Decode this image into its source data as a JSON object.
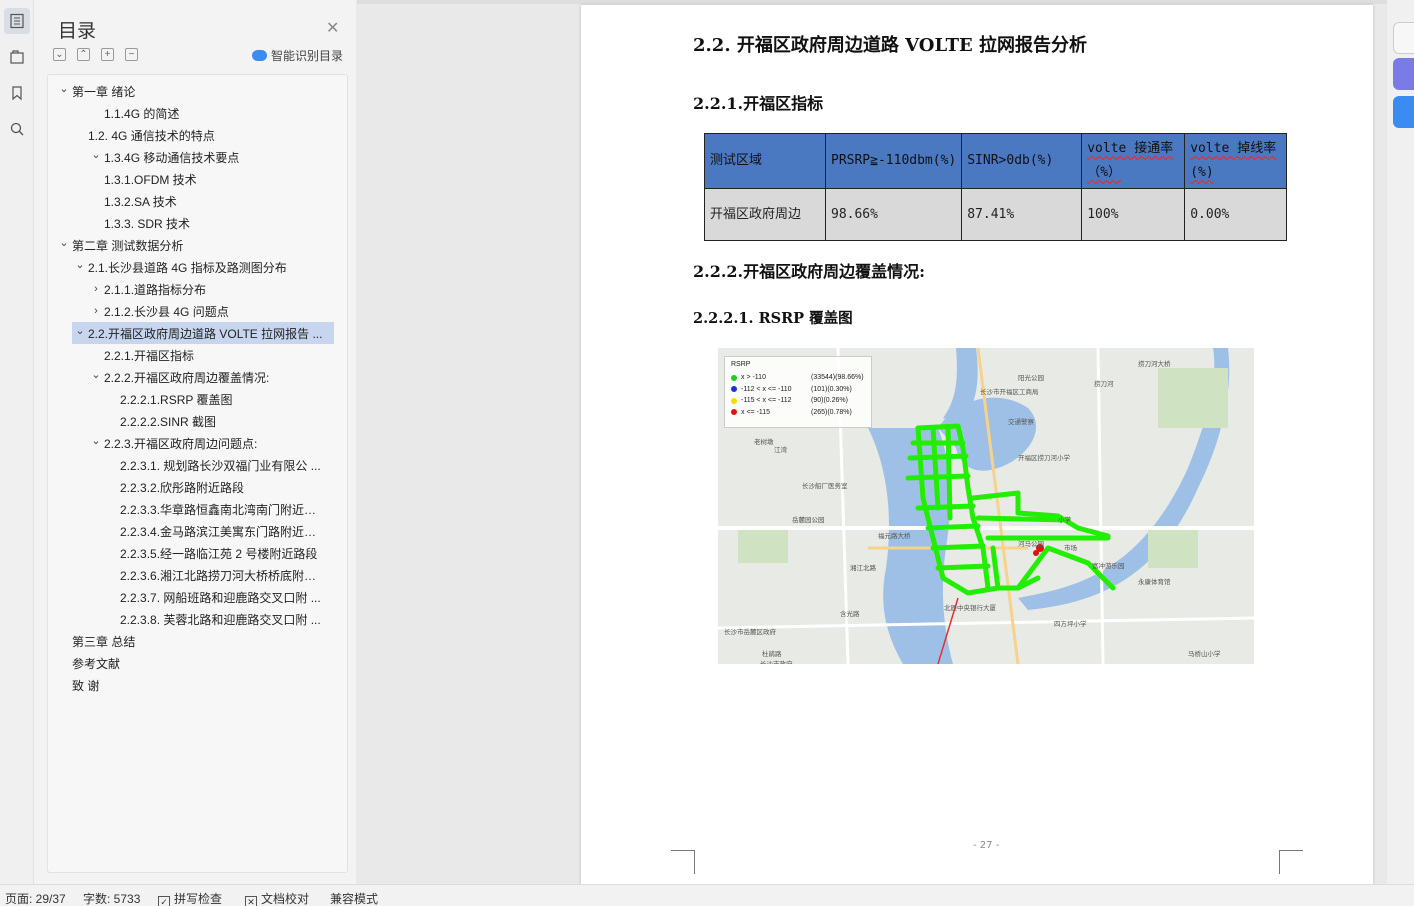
{
  "toc_panel": {
    "title": "目录",
    "smart_toc_label": "智能识别目录",
    "items": [
      {
        "label": "第一章  绪论",
        "caret": "v"
      },
      {
        "label": "1.1.4G 的简述",
        "caret": ""
      },
      {
        "label": "1.2.  4G 通信技术的特点",
        "caret": ""
      },
      {
        "label": "1.3.4G 移动通信技术要点",
        "caret": "v"
      },
      {
        "label": "1.3.1.OFDM 技术",
        "caret": ""
      },
      {
        "label": "1.3.2.SA 技术",
        "caret": ""
      },
      {
        "label": "1.3.3.  SDR 技术",
        "caret": ""
      },
      {
        "label": "第二章  测试数据分析",
        "caret": "v"
      },
      {
        "label": "2.1.长沙县道路 4G 指标及路测图分布",
        "caret": "v"
      },
      {
        "label": "2.1.1.道路指标分布",
        "caret": ">"
      },
      {
        "label": "2.1.2.长沙县 4G 问题点",
        "caret": ">"
      },
      {
        "label": "2.2.开福区政府周边道路 VOLTE 拉网报告 ...",
        "caret": "v",
        "selected": true
      },
      {
        "label": "2.2.1.开福区指标",
        "caret": ""
      },
      {
        "label": "2.2.2.开福区政府周边覆盖情况:",
        "caret": "v"
      },
      {
        "label": "2.2.2.1.RSRP 覆盖图",
        "caret": ""
      },
      {
        "label": "2.2.2.2.SINR 截图",
        "caret": ""
      },
      {
        "label": "2.2.3.开福区政府周边问题点:",
        "caret": "v"
      },
      {
        "label": "2.2.3.1.  规划路长沙双福门业有限公 ...",
        "caret": ""
      },
      {
        "label": "2.2.3.2.欣彤路附近路段",
        "caret": ""
      },
      {
        "label": "2.2.3.3.华章路恒鑫南北湾南门附近路 ...",
        "caret": ""
      },
      {
        "label": "2.2.3.4.金马路滨江美寓东门路附近路 ...",
        "caret": ""
      },
      {
        "label": "2.2.3.5.经一路临江苑 2 号楼附近路段",
        "caret": ""
      },
      {
        "label": "2.2.3.6.湘江北路捞刀河大桥桥底附近 ...",
        "caret": ""
      },
      {
        "label": "2.2.3.7.  网船班路和迎鹿路交叉口附 ...",
        "caret": ""
      },
      {
        "label": "2.2.3.8.  芙蓉北路和迎鹿路交叉口附 ...",
        "caret": ""
      },
      {
        "label": "第三章  总结",
        "caret": ""
      },
      {
        "label": "参考文献",
        "caret": ""
      },
      {
        "label": "致    谢",
        "caret": ""
      }
    ]
  },
  "document": {
    "section_title": "2.2.   开福区政府周边道路 VOLTE 拉网报告分析",
    "sub_title_1": "2.2.1.开福区指标",
    "table": {
      "headers": [
        "测试区域",
        "PRSRP≧-110dbm(%)",
        "SINR>0db(%)",
        "volte 接通率（%）",
        "volte 掉线率(%)"
      ],
      "rows": [
        [
          "开福区政府周边",
          "98.66%",
          "87.41%",
          "100%",
          "0.00%"
        ]
      ]
    },
    "sub_title_2": "2.2.2.开福区政府周边覆盖情况:",
    "subsub_title": "2.2.2.1.   RSRP 覆盖图",
    "map_legend": {
      "title": "RSRP",
      "entries": [
        {
          "range": "x > -110",
          "stat": "(33544)(98.66%)",
          "color": "#22cc22"
        },
        {
          "range": "-112 < x <= -110",
          "stat": "(101)(0.30%)",
          "color": "#1a35d6"
        },
        {
          "range": "-115 < x <= -112",
          "stat": "(90)(0.26%)",
          "color": "#f0e000"
        },
        {
          "range": "x <= -115",
          "stat": "(265)(0.78%)",
          "color": "#e01010"
        }
      ]
    },
    "map_labels": [
      "长沙市开福区工商局",
      "阳光公园",
      "交通警察",
      "开福区捞刀河小学",
      "长沙船厂医务室",
      "岳麓园公园",
      "福元路大桥",
      "湘江北路",
      "老树墩",
      "江湾",
      "小学",
      "河马公园",
      "市场",
      "富冲游乐园",
      "永康体育馆",
      "长沙市岳麓区政府",
      "杜鹃路",
      "北辰中央银行大厦",
      "四方坪小学",
      "捞刀河",
      "马桥山小学",
      "长沙市政府",
      "含光路",
      "捞刀河大桥"
    ],
    "page_number": "- 27 -"
  },
  "status_bar": {
    "page": "页面: 29/37",
    "words": "字数: 5733",
    "spell_check": "拼写检查",
    "doc_check": "文档校对",
    "compat_mode": "兼容模式"
  }
}
